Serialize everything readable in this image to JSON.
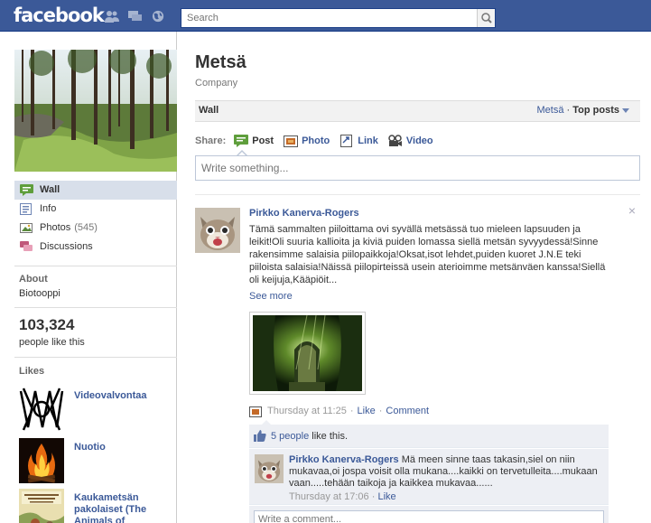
{
  "topbar": {
    "logo": "facebook",
    "search_placeholder": "Search"
  },
  "page": {
    "name": "Metsä",
    "category": "Company"
  },
  "nav": {
    "items": [
      {
        "label": "Wall",
        "count": ""
      },
      {
        "label": "Info",
        "count": ""
      },
      {
        "label": "Photos",
        "count": "(545)"
      },
      {
        "label": "Discussions",
        "count": ""
      }
    ]
  },
  "about": {
    "heading": "About",
    "value": "Biotooppi"
  },
  "fans": {
    "count": "103,324",
    "label": "people like this"
  },
  "likes": {
    "heading": "Likes",
    "items": [
      {
        "name": "Videovalvontaa"
      },
      {
        "name": "Nuotio"
      },
      {
        "name": "Kaukametsän pakolaiset (The Animals of"
      }
    ]
  },
  "wall": {
    "title": "Wall",
    "filter_page": "Metsä",
    "filter_sep": "·",
    "filter_mode": "Top posts"
  },
  "share": {
    "label": "Share:",
    "options": [
      {
        "label": "Post"
      },
      {
        "label": "Photo"
      },
      {
        "label": "Link"
      },
      {
        "label": "Video"
      }
    ],
    "composer_placeholder": "Write something..."
  },
  "story": {
    "author": "Pirkko Kanerva-Rogers",
    "text": "Tämä sammalten piiloittama ovi syvällä metsässä tuo mieleen lapsuuden ja leikit!Oli suuria kallioita ja kiviä puiden lomassa siellä metsän syvyydessä!Sinne rakensimme salaisia piilopaikkoja!Oksat,isot lehdet,puiden kuoret J.N.E teki piiloista salaisia!Näissä piilopirteissä usein aterioimme metsänväen kanssa!Siellä oli keijuja,Kääpiöit...",
    "see_more": "See more",
    "timestamp": "Thursday at 11:25",
    "dot1": "·",
    "like_action": "Like",
    "dot2": "·",
    "comment_action": "Comment",
    "close": "×"
  },
  "ufi": {
    "likes_link": "5 people",
    "likes_suffix": "like this.",
    "comment": {
      "author": "Pirkko Kanerva-Rogers",
      "text": "Mä meen sinne taas takasin,siel on niin mukavaa,oi jospa voisit olla mukana....kaikki on tervetulleita....mukaan vaan.....tehään taikoja ja kaikkea mukavaa......",
      "timestamp": "Thursday at 17:06",
      "dot": "·",
      "like_action": "Like"
    },
    "write_placeholder": "Write a comment..."
  },
  "colors": {
    "brand": "#3b5998",
    "nav_active_bg": "#d8dfea",
    "ufi_bg": "#edeff4"
  }
}
